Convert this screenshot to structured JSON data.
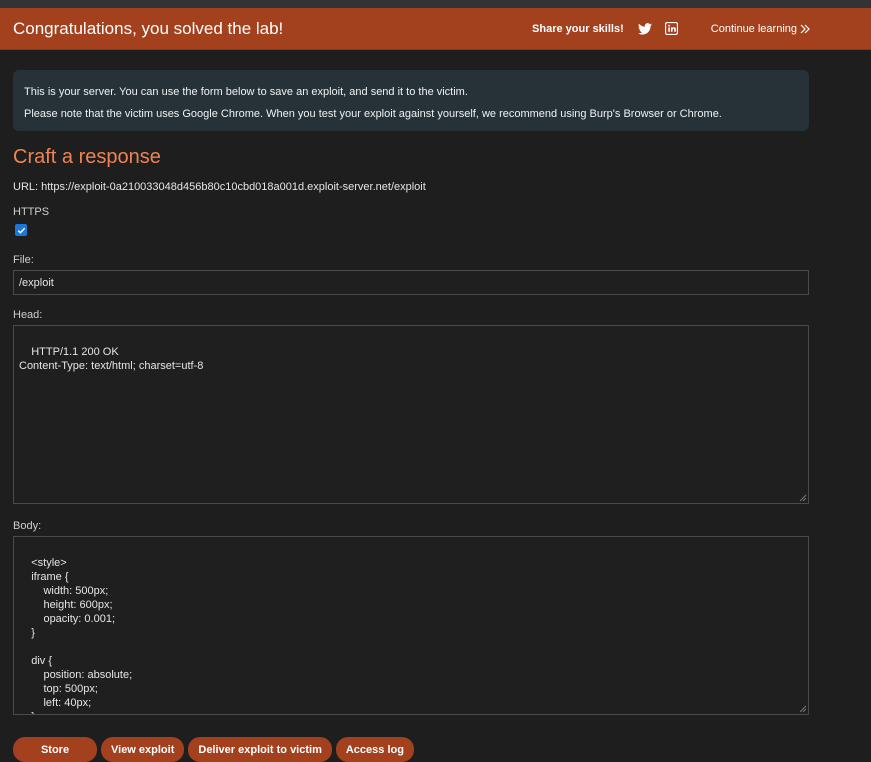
{
  "banner": {
    "title": "Congratulations, you solved the lab!",
    "share_label": "Share your skills!",
    "continue_label": "Continue learning"
  },
  "info": {
    "line1": "This is your server. You can use the form below to save an exploit, and send it to the victim.",
    "line2": "Please note that the victim uses Google Chrome. When you test your exploit against yourself, we recommend using Burp's Browser or Chrome."
  },
  "form": {
    "heading": "Craft a response",
    "url": "URL: https://exploit-0a210033048d456b80c10cbd018a001d.exploit-server.net/exploit",
    "https_label": "HTTPS",
    "https_checked": true,
    "file_label": "File:",
    "file_value": "/exploit",
    "head_label": "Head:",
    "head_value": "HTTP/1.1 200 OK\nContent-Type: text/html; charset=utf-8",
    "body_label": "Body:",
    "body_value": "<style>\n    iframe {\n        width: 500px;\n        height: 600px;\n        opacity: 0.001;\n    }\n\n    div {\n        position: absolute;\n        top: 500px;\n        left: 40px;\n    }\n</style>"
  },
  "buttons": {
    "store": "Store",
    "view": "View exploit",
    "deliver": "Deliver exploit to victim",
    "log": "Access log"
  },
  "colors": {
    "accent": "#a3411f",
    "heading": "#ef8355",
    "info_bg": "#263238"
  }
}
